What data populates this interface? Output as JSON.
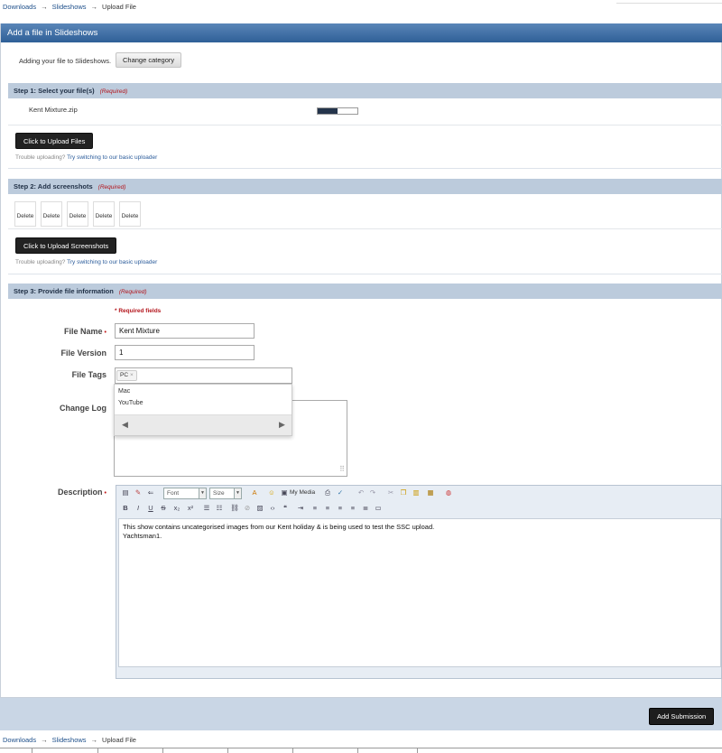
{
  "breadcrumb": {
    "items": [
      "Downloads",
      "Slideshows",
      "Upload File"
    ],
    "separator": "→"
  },
  "panel": {
    "title": "Add a file in Slideshows"
  },
  "intro": {
    "text": "Adding your file to Slideshows.",
    "change_category_label": "Change category"
  },
  "step1": {
    "title": "Step 1: Select your file(s)",
    "required": "(Required)",
    "file_name": "Kent Mixture.zip",
    "progress_fraction": 0.5,
    "upload_button": "Click to Upload Files",
    "hint_prefix": "Trouble uploading?",
    "hint_link": "Try switching to our basic uploader"
  },
  "step2": {
    "title": "Step 2: Add screenshots",
    "required": "(Required)",
    "thumbs": [
      "Delete",
      "Delete",
      "Delete",
      "Delete",
      "Delete"
    ],
    "upload_button": "Click to Upload Screenshots",
    "hint_prefix": "Trouble uploading?",
    "hint_link": "Try switching to our basic uploader"
  },
  "step3": {
    "title": "Step 3: Provide file information",
    "required": "(Required)",
    "required_note": "* Required fields",
    "file_name_label": "File Name",
    "file_name_value": "Kent Mixture",
    "file_version_label": "File Version",
    "file_version_value": "1",
    "file_tags_label": "File Tags",
    "tag_chip": "PC",
    "tag_chip_remove": "×",
    "tag_options": [
      "Mac",
      "YouTube"
    ],
    "change_log_label": "Change Log",
    "description_label": "Description",
    "star": "•"
  },
  "editor": {
    "font_label": "Font",
    "size_label": "Size",
    "my_media_label": "My Media",
    "content_line1": "This show contains uncategorised images from our Kent holiday & is being used to test the SSC upload.",
    "content_line2": "Yachtsman1."
  },
  "submit": {
    "label": "Add Submission"
  },
  "colors": {
    "header": "#2f5f97",
    "step_bar": "#bccbdc",
    "required": "#b3141b",
    "link": "#1d4f8a"
  }
}
